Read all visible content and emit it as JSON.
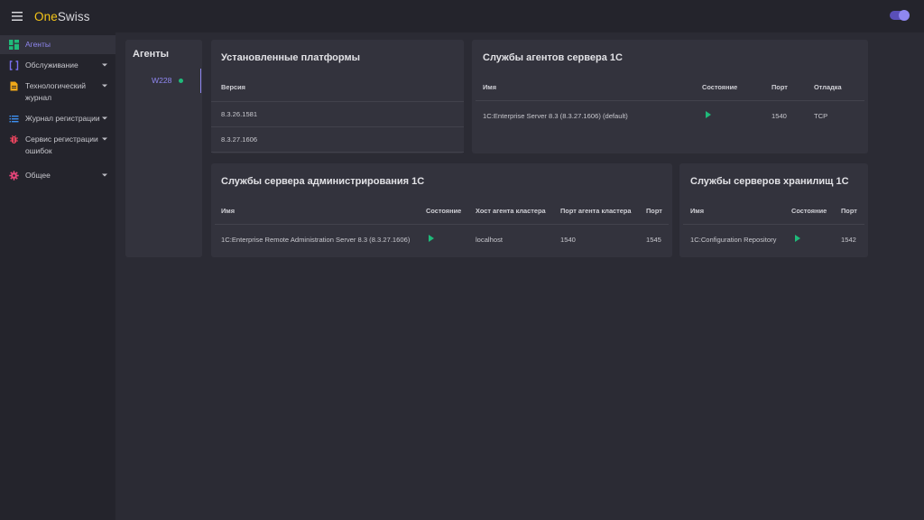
{
  "app": {
    "brand_part1": "One",
    "brand_part2": "Swiss"
  },
  "sidebar": {
    "items": [
      {
        "label": "Агенты",
        "icon": "dashboard-icon",
        "active": true
      },
      {
        "label": "Обслуживание",
        "icon": "brackets-icon"
      },
      {
        "label": "Технологический журнал",
        "icon": "document-icon"
      },
      {
        "label": "Журнал регистрации",
        "icon": "list-icon"
      },
      {
        "label": "Сервис регистрации ошибок",
        "icon": "bug-icon"
      },
      {
        "label": "Общее",
        "icon": "gear-icon"
      }
    ]
  },
  "agents": {
    "title": "Агенты",
    "items": [
      {
        "name": "W228",
        "status": "online"
      }
    ]
  },
  "platforms": {
    "title": "Установленные платформы",
    "header": "Версия",
    "rows": [
      "8.3.26.1581",
      "8.3.27.1606"
    ]
  },
  "agent_services": {
    "title": "Службы агентов сервера 1С",
    "headers": {
      "name": "Имя",
      "state": "Состояние",
      "port": "Порт",
      "debug": "Отладка"
    },
    "rows": [
      {
        "name": "1C:Enterprise Server 8.3 (8.3.27.1606) (default)",
        "state": "running",
        "port": "1540",
        "debug": "TCP"
      }
    ]
  },
  "admin_services": {
    "title": "Службы сервера администрирования 1С",
    "headers": {
      "name": "Имя",
      "state": "Состояние",
      "host": "Хост агента кластера",
      "cluster_port": "Порт агента кластера",
      "port": "Порт"
    },
    "rows": [
      {
        "name": "1C:Enterprise Remote Administration Server 8.3 (8.3.27.1606)",
        "state": "running",
        "host": "localhost",
        "cluster_port": "1540",
        "port": "1545"
      }
    ]
  },
  "repo_services": {
    "title": "Службы серверов хранилищ 1С",
    "headers": {
      "name": "Имя",
      "state": "Состояние",
      "port": "Порт"
    },
    "rows": [
      {
        "name": "1C:Configuration Repository",
        "state": "running",
        "port": "1542"
      }
    ]
  },
  "colors": {
    "accent": "#8f87f0",
    "brand": "#f5c518",
    "status_ok": "#1fba7a"
  }
}
